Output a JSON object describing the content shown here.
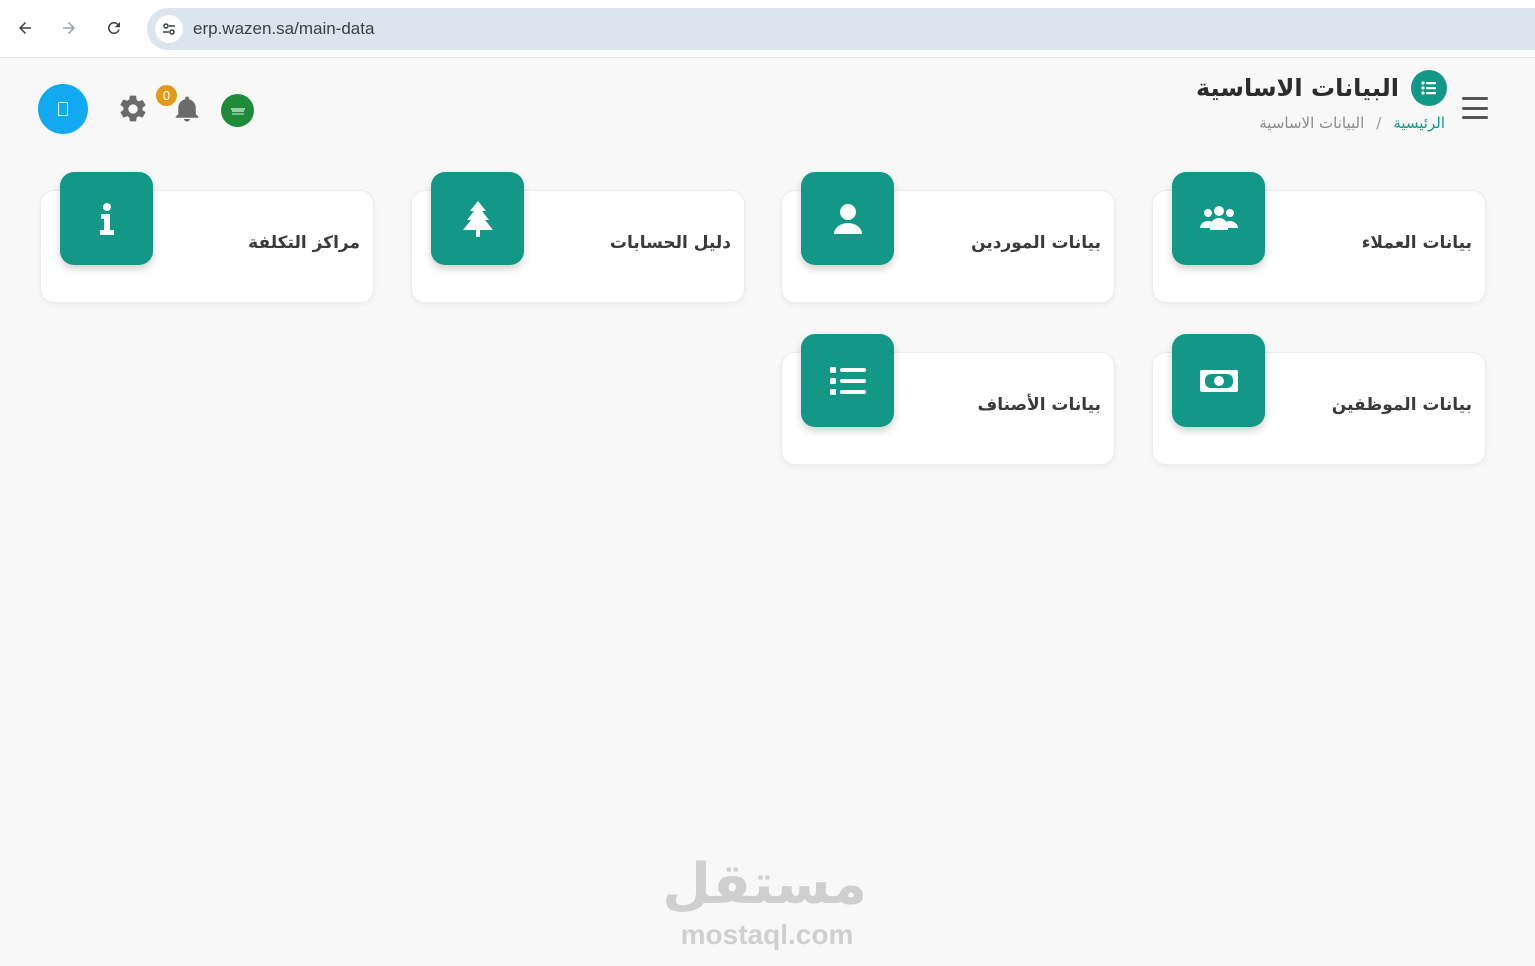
{
  "browser": {
    "url": "erp.wazen.sa/main-data",
    "back_icon": "arrow-left-icon",
    "forward_icon": "arrow-right-icon",
    "reload_icon": "reload-icon",
    "site_info_icon": "tune-icon"
  },
  "header": {
    "title": "البيانات الاساسية",
    "title_icon": "list-icon",
    "breadcrumb": {
      "home": "الرئيسية",
      "separator": "/",
      "current": "البيانات الاساسية"
    },
    "menu_icon": "hamburger-icon"
  },
  "toolbar": {
    "notification_count": "0",
    "settings_icon": "gear-icon",
    "notifications_icon": "bell-icon",
    "language_icon": "saudi-flag-icon",
    "avatar_icon": "user-avatar-icon"
  },
  "cards": [
    {
      "label": "بيانات العملاء",
      "icon": "users-icon"
    },
    {
      "label": "بيانات الموردين",
      "icon": "user-icon"
    },
    {
      "label": "دليل الحسابات",
      "icon": "tree-icon"
    },
    {
      "label": "مراكز التكلفة",
      "icon": "info-icon"
    },
    {
      "label": "بيانات الموظفين",
      "icon": "money-bill-icon"
    },
    {
      "label": "بيانات الأصناف",
      "icon": "list-icon"
    }
  ],
  "watermark": {
    "arabic": "مستقل",
    "latin": "mostaql.com"
  },
  "colors": {
    "primary": "#139887",
    "avatar": "#11a9f0",
    "badge": "#e39a15",
    "flag": "#1f8a38"
  }
}
